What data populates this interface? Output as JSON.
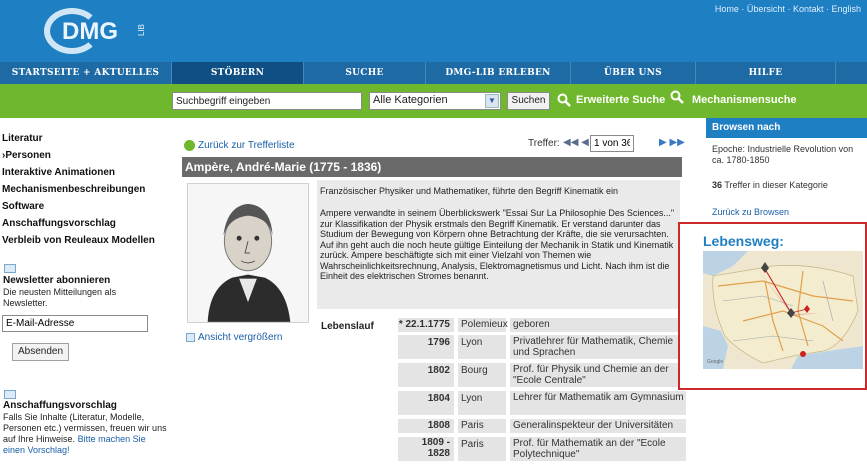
{
  "header": {
    "logo_text": "DMG",
    "logo_sub": "LIB",
    "topnav": [
      "Home",
      "Übersicht",
      "Kontakt",
      "English"
    ]
  },
  "mainnav": [
    {
      "label": "STARTSEITE + AKTUELLES",
      "active": false
    },
    {
      "label": "STÖBERN",
      "active": true
    },
    {
      "label": "SUCHE",
      "active": false
    },
    {
      "label": "DMG-LIB ERLEBEN",
      "active": false
    },
    {
      "label": "ÜBER UNS",
      "active": false
    },
    {
      "label": "HILFE",
      "active": false
    }
  ],
  "search": {
    "placeholder": "Suchbegriff eingeben",
    "category": "Alle Kategorien",
    "button": "Suchen",
    "advanced": "Erweiterte Suche",
    "mechanism": "Mechanismensuche"
  },
  "leftnav": {
    "items": [
      "Literatur",
      "›Personen",
      "Interaktive Animationen",
      "Mechanismenbeschreibungen",
      "Software",
      "Anschaffungsvorschlag",
      "Verbleib von Reuleaux Modellen"
    ],
    "newsletter_title": "Newsletter abonnieren",
    "newsletter_desc": "Die neusten Mitteilungen als Newsletter.",
    "email_placeholder": "E-Mail-Adresse",
    "submit": "Absenden",
    "suggest_title": "Anschaffungsvorschlag",
    "suggest_desc": "Falls Sie Inhalte (Literatur, Modelle, Personen etc.) vermissen, freuen wir uns auf Ihre Hinweise.",
    "suggest_link": "Bitte machen Sie einen Vorschlag!"
  },
  "main": {
    "back_label": "Zurück zur Trefferliste",
    "hits_label": "Treffer:",
    "hits_value": "1 von 36",
    "title": "Ampère, André-Marie (1775 - 1836)",
    "enlarge": "Ansicht vergrößern",
    "desc_p1": "Französischer Physiker und Mathematiker, führte den Begriff Kinematik ein",
    "desc_p2": "Ampere verwandte in seinem Überblickswerk \"Essai Sur La Philosophie Des Sciences...\" zur Klassifikation der Physik erstmals den Begriff Kinematik. Er verstand darunter das Studium der Bewegung von Körpern ohne Betrachtung der Kräfte, die sie verursachten. Auf ihn geht auch die noch heute gültige Einteilung der Mechanik in Statik und Kinematik zurück. Ampere beschäftigte sich mit einer Vielzahl von Themen wie Wahrscheinlichkeitsrechnung, Analysis, Elektromagnetismus und Licht. Nach ihm ist die Einheit des elektrischen Stromes benannt.",
    "lebenslauf_label": "Lebenslauf",
    "lebenslauf": [
      {
        "date": "* 22.1.1775",
        "place": "Polemieux",
        "text": "geboren"
      },
      {
        "date": "1796",
        "place": "Lyon",
        "text": "Privatlehrer für Mathematik, Chemie und Sprachen"
      },
      {
        "date": "1802",
        "place": "Bourg",
        "text": "Prof. für Physik und Chemie an der \"Ecole Centrale\""
      },
      {
        "date": "1804",
        "place": "Lyon",
        "text": "Lehrer für Mathematik am Gymnasium"
      },
      {
        "date": "1808",
        "place": "Paris",
        "text": "Generalinspekteur der Universitäten"
      },
      {
        "date": "1809 - 1828",
        "place": "Paris",
        "text": "Prof. für Mathematik an der \"Ecole Polytechnique\""
      }
    ]
  },
  "right": {
    "browse_title": "Browsen nach",
    "epoch": "Epoche: Industrielle Revolution von ca. 1780-1850",
    "hits_count": "36",
    "hits_text": "Treffer in dieser Kategorie",
    "back_browse": "Zurück zu Browsen",
    "lebensweg": "Lebensweg:"
  },
  "colors": {
    "header_blue": "#1f7fc3",
    "nav_blue": "#1d6aa5",
    "nav_active": "#0f4f84",
    "search_green": "#6fb72d",
    "link_blue": "#1a5fa8",
    "highlight_red": "#cc2a2a"
  }
}
